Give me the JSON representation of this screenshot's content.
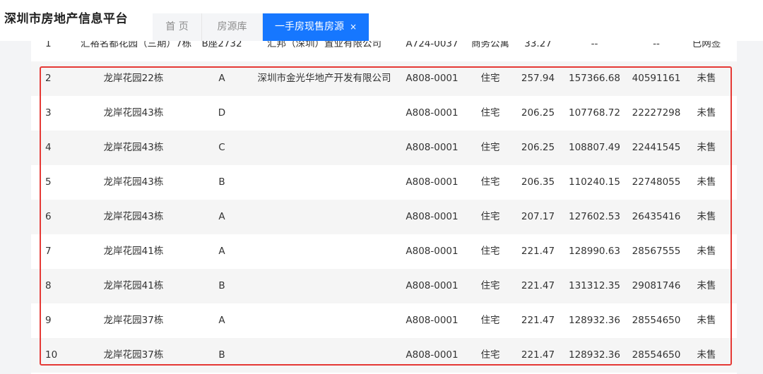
{
  "header": {
    "app_title": "深圳市房地产信息平台",
    "tabs": [
      {
        "label": "首 页"
      },
      {
        "label": "房源库"
      },
      {
        "label": "一手房现售房源",
        "close": "×"
      }
    ]
  },
  "table": {
    "rows": [
      {
        "no": "1",
        "project": "汇裕名都花园（三期）7栋",
        "unit": "B座2732",
        "company": "汇邦（深圳）置业有限公司",
        "code": "A724-0037",
        "type": "商务公寓",
        "area": "33.27",
        "unit_price": "--",
        "total_price": "--",
        "status": "已网签"
      },
      {
        "no": "2",
        "project": "龙岸花园22栋",
        "unit": "A",
        "company": "深圳市金光华地产开发有限公司",
        "code": "A808-0001",
        "type": "住宅",
        "area": "257.94",
        "unit_price": "157366.68",
        "total_price": "40591161",
        "status": "未售"
      },
      {
        "no": "3",
        "project": "龙岸花园43栋",
        "unit": "D",
        "company": "",
        "code": "A808-0001",
        "type": "住宅",
        "area": "206.25",
        "unit_price": "107768.72",
        "total_price": "22227298",
        "status": "未售"
      },
      {
        "no": "4",
        "project": "龙岸花园43栋",
        "unit": "C",
        "company": "",
        "code": "A808-0001",
        "type": "住宅",
        "area": "206.25",
        "unit_price": "108807.49",
        "total_price": "22441545",
        "status": "未售"
      },
      {
        "no": "5",
        "project": "龙岸花园43栋",
        "unit": "B",
        "company": "",
        "code": "A808-0001",
        "type": "住宅",
        "area": "206.35",
        "unit_price": "110240.15",
        "total_price": "22748055",
        "status": "未售"
      },
      {
        "no": "6",
        "project": "龙岸花园43栋",
        "unit": "A",
        "company": "",
        "code": "A808-0001",
        "type": "住宅",
        "area": "207.17",
        "unit_price": "127602.53",
        "total_price": "26435416",
        "status": "未售"
      },
      {
        "no": "7",
        "project": "龙岸花园41栋",
        "unit": "A",
        "company": "",
        "code": "A808-0001",
        "type": "住宅",
        "area": "221.47",
        "unit_price": "128990.63",
        "total_price": "28567555",
        "status": "未售"
      },
      {
        "no": "8",
        "project": "龙岸花园41栋",
        "unit": "B",
        "company": "",
        "code": "A808-0001",
        "type": "住宅",
        "area": "221.47",
        "unit_price": "131312.35",
        "total_price": "29081746",
        "status": "未售"
      },
      {
        "no": "9",
        "project": "龙岸花园37栋",
        "unit": "A",
        "company": "",
        "code": "A808-0001",
        "type": "住宅",
        "area": "221.47",
        "unit_price": "128932.36",
        "total_price": "28554650",
        "status": "未售"
      },
      {
        "no": "10",
        "project": "龙岸花园37栋",
        "unit": "B",
        "company": "",
        "code": "A808-0001",
        "type": "住宅",
        "area": "221.47",
        "unit_price": "128932.36",
        "total_price": "28554650",
        "status": "未售"
      }
    ]
  },
  "colors": {
    "accent": "#1677ff",
    "highlight_border": "#e53935",
    "row_alt": "#f5f5f5"
  }
}
